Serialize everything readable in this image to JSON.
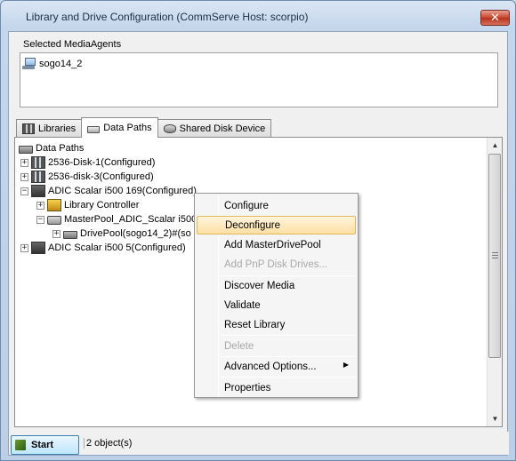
{
  "window": {
    "title": "Library and Drive Configuration (CommServe Host: scorpio)",
    "close_label": "✕"
  },
  "media_agents": {
    "group_label": "Selected MediaAgents",
    "items": [
      {
        "label": "sogo14_2",
        "icon": "computer-icon"
      }
    ]
  },
  "tabs": [
    {
      "label": "Libraries",
      "icon": "libraries-icon"
    },
    {
      "label": "Data Paths",
      "icon": "datapaths-icon",
      "active": true
    },
    {
      "label": "Shared Disk Device",
      "icon": "shared-disk-icon"
    }
  ],
  "tree": {
    "root": "Data Paths",
    "nodes": [
      {
        "label": "2536-Disk-1(Configured)",
        "icon": "disk-library-icon",
        "expander": "+"
      },
      {
        "label": "2536-disk-3(Configured)",
        "icon": "disk-library-icon",
        "expander": "+"
      },
      {
        "label": "ADIC Scalar i500 169(Configured)",
        "icon": "tape-library-icon",
        "expander": "−"
      },
      {
        "label": "Library Controller",
        "icon": "controller-icon",
        "expander": "+"
      },
      {
        "label": "MasterPool_ADIC_Scalar i500",
        "icon": "drive-pool-icon",
        "expander": "−"
      },
      {
        "label": "DrivePool(sogo14_2)#(so",
        "icon": "drive-icon",
        "expander": "+"
      },
      {
        "label": "ADIC Scalar i500 5(Configured)",
        "icon": "tape-library-icon",
        "expander": "+"
      }
    ]
  },
  "context_menu": {
    "items": [
      {
        "label": "Configure",
        "disabled": false
      },
      {
        "label": "Deconfigure",
        "disabled": false,
        "hover": true
      },
      {
        "label": "Add MasterDrivePool",
        "disabled": false
      },
      {
        "label": "Add PnP Disk Drives...",
        "disabled": true
      },
      {
        "label": "Discover Media",
        "disabled": false
      },
      {
        "label": "Validate",
        "disabled": false
      },
      {
        "label": "Reset Library",
        "disabled": false
      },
      {
        "label": "Delete",
        "disabled": true
      },
      {
        "label": "Advanced Options...",
        "disabled": false,
        "submenu": true
      },
      {
        "label": "Properties",
        "disabled": false
      }
    ],
    "submenu_arrow": "▶"
  },
  "status": {
    "start_label": "Start",
    "objects_text": "2 object(s)"
  },
  "scrollbar": {
    "up": "▲",
    "down": "▼"
  },
  "colors": {
    "hover_bg": "#fedfa3",
    "selection_border": "#e3b85b",
    "window_frame": "#c4d6ec",
    "disabled_text": "#a8a8a8"
  }
}
